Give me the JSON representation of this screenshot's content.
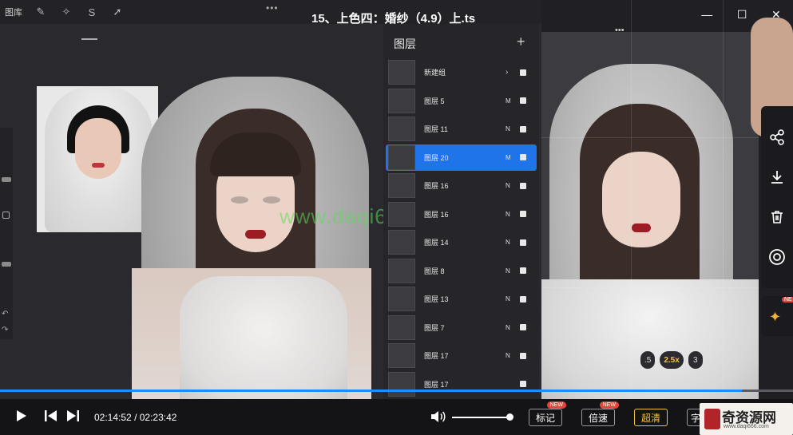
{
  "video": {
    "title": "15、上色四：婚纱（4.9）上.ts",
    "current_time": "02:14:52",
    "total_time": "02:23:42",
    "time_separator": "/",
    "progress": 0.936,
    "volume": 0.95
  },
  "procreate": {
    "gallery_label": "图库",
    "top_dots": "•••",
    "layers_title": "图层",
    "add_symbol": "+",
    "layers": [
      {
        "name": "新建组",
        "mode": "",
        "has_arrow": true,
        "selected": false
      },
      {
        "name": "图层 5",
        "mode": "M",
        "selected": false
      },
      {
        "name": "图层 11",
        "mode": "N",
        "selected": false
      },
      {
        "name": "图层 20",
        "mode": "M",
        "selected": true
      },
      {
        "name": "图层 16",
        "mode": "N",
        "selected": false
      },
      {
        "name": "图层 16",
        "mode": "N",
        "selected": false
      },
      {
        "name": "图层 14",
        "mode": "N",
        "selected": false
      },
      {
        "name": "图层 8",
        "mode": "N",
        "selected": false
      },
      {
        "name": "图层 13",
        "mode": "N",
        "selected": false
      },
      {
        "name": "图层 7",
        "mode": "N",
        "selected": false
      },
      {
        "name": "图层 17",
        "mode": "N",
        "selected": false
      },
      {
        "name": "图层 17",
        "mode": "",
        "selected": false
      }
    ],
    "group_arrow": "›"
  },
  "watermark": "www.daqi666.com",
  "right_panel": {
    "dots": "•••",
    "speed_options": [
      ".5",
      "2.5x",
      "3"
    ],
    "active_speed": "2.5x"
  },
  "window_controls": {
    "minimize": "—",
    "maximize": "☐",
    "close": "✕"
  },
  "side_actions": {
    "share_icon": "share-icon",
    "download_icon": "download-icon",
    "delete_icon": "trash-icon",
    "target_icon": "target-icon",
    "pin_icon": "pin-icon",
    "pin_tag": "NE"
  },
  "player_buttons": {
    "mark": "标记",
    "speed": "倍速",
    "quality": "超清",
    "subtitle": "字",
    "new_tag": "NEW"
  },
  "brand": {
    "name": "奇资源网",
    "url": "www.daqi666.com"
  },
  "colors": {
    "accent": "#1e8bff",
    "selected_layer": "#1e74e8",
    "highlight": "#f2c33b",
    "badge": "#e3443b"
  }
}
